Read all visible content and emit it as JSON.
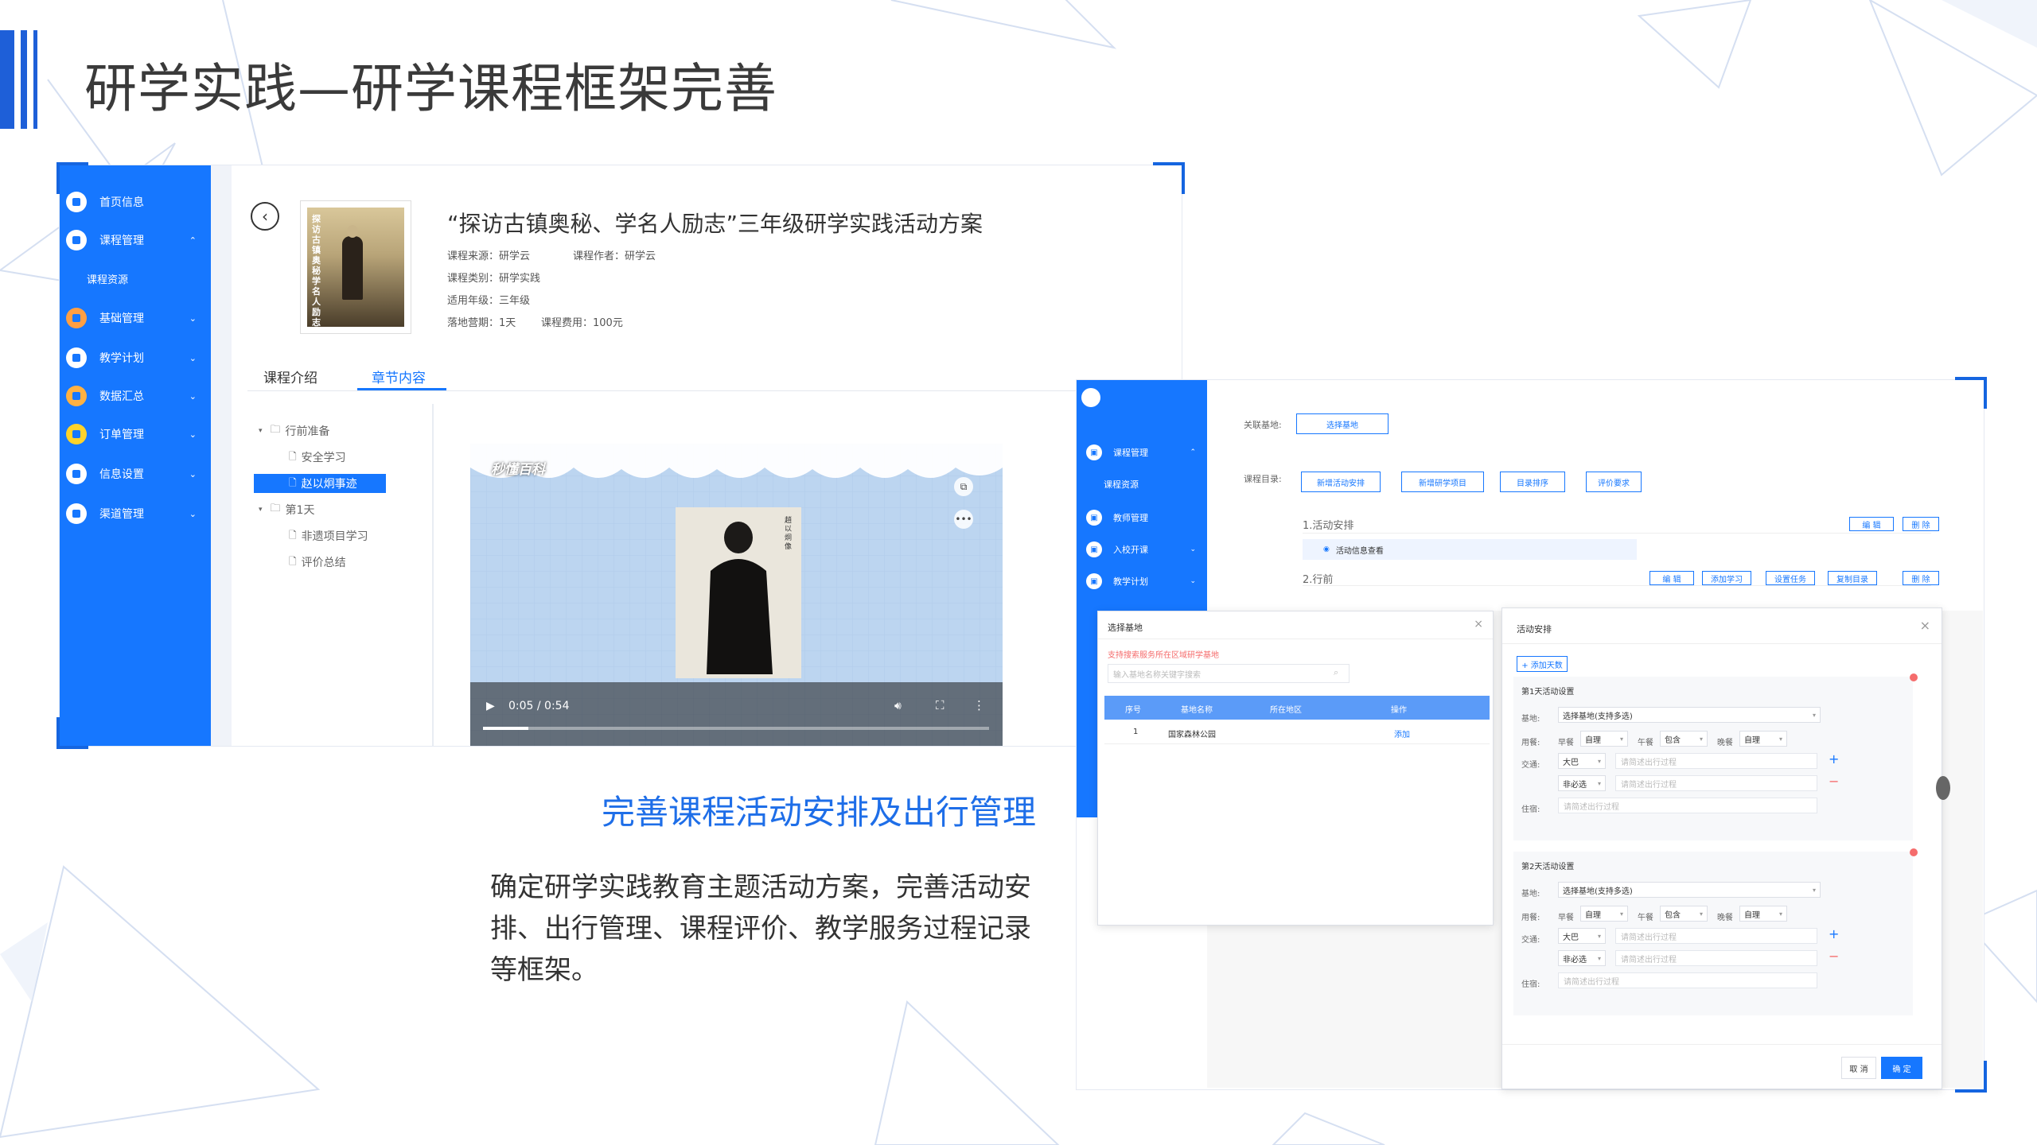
{
  "page": {
    "title": "研学实践—研学课程框架完善",
    "subhead": "完善课程活动安排及出行管理",
    "description": "确定研学实践教育主题活动方案，完善活动安排、出行管理、课程评价、教学服务过程记录等框架。"
  },
  "shot1": {
    "sidebar": [
      {
        "label": "首页信息",
        "icon": "home-icon",
        "expanded": false,
        "color": "#ffffff"
      },
      {
        "label": "课程管理",
        "icon": "course-icon",
        "expanded": true,
        "color": "#ffffff"
      },
      {
        "label": "课程资源",
        "icon": "",
        "sub": true
      },
      {
        "label": "基础管理",
        "icon": "basic-icon",
        "expanded": false,
        "color": "#ff9f43"
      },
      {
        "label": "教学计划",
        "icon": "monitor-icon",
        "expanded": false,
        "color": "#ffffff"
      },
      {
        "label": "数据汇总",
        "icon": "pie-icon",
        "expanded": false,
        "color": "#ffb142"
      },
      {
        "label": "订单管理",
        "icon": "clipboard-icon",
        "expanded": false,
        "color": "#ffd32a"
      },
      {
        "label": "信息设置",
        "icon": "gear-icon",
        "expanded": false,
        "color": "#ffffff"
      },
      {
        "label": "渠道管理",
        "icon": "channel-icon",
        "expanded": false,
        "color": "#ffffff"
      }
    ],
    "course": {
      "title": "“探访古镇奥秘、学名人励志”三年级研学实践活动方案",
      "source": "课程来源：研学云",
      "author": "课程作者：研学云",
      "category": "课程类别：研学实践",
      "grade": "适用年级：三年级",
      "duration": "落地营期：1天",
      "fee": "课程费用：100元",
      "cover_text": "探访古镇奥秘学名人励志"
    },
    "tabs": [
      "课程介绍",
      "章节内容"
    ],
    "active_tab": 1,
    "tree": [
      {
        "label": "行前准备",
        "type": "folder",
        "level": 0
      },
      {
        "label": "安全学习",
        "type": "file",
        "level": 1
      },
      {
        "label": "赵以炯事迹",
        "type": "file",
        "level": 1,
        "selected": true
      },
      {
        "label": "第1天",
        "type": "folder",
        "level": 0
      },
      {
        "label": "非遗项目学习",
        "type": "file",
        "level": 1
      },
      {
        "label": "评价总结",
        "type": "file",
        "level": 1
      }
    ],
    "video": {
      "watermark": "秒懂百科",
      "portrait_caption": "趙以炯像",
      "time": "0:05 / 0:54",
      "progress": 0.09
    }
  },
  "shot2": {
    "sidebar": [
      {
        "label": "课程管理",
        "icon": "course-icon",
        "chev": "⌃"
      },
      {
        "label": "课程资源",
        "icon": "",
        "sub": true
      },
      {
        "label": "教师管理",
        "icon": "teacher-icon",
        "chev": ""
      },
      {
        "label": "入校开课",
        "icon": "school-icon",
        "chev": "⌄"
      },
      {
        "label": "教学计划",
        "icon": "monitor-icon",
        "chev": "⌄"
      }
    ],
    "related_base_label": "关联基地:",
    "select_base_btn": "选择基地",
    "catalog_label": "课程目录:",
    "catalog_buttons": [
      "新增活动安排",
      "新增研学项目",
      "目录排序",
      "评价要求"
    ],
    "sections": [
      {
        "label": "1.活动安排",
        "buttons": [
          "编 辑",
          "删 除"
        ]
      },
      {
        "label": "2.行前",
        "buttons": [
          "编 辑",
          "添加学习",
          "设置任务",
          "复制目录",
          "删 除"
        ]
      }
    ],
    "sub_item": "活动信息查看",
    "base_modal": {
      "title": "选择基地",
      "hint": "支持搜索服务所在区域研学基地",
      "search_placeholder": "输入基地名称关键字搜索",
      "columns": [
        "序号",
        "基地名称",
        "所在地区",
        "操作"
      ],
      "rows": [
        {
          "no": "1",
          "name": "国家森林公园",
          "region": "",
          "action": "添加"
        }
      ]
    },
    "activity_modal": {
      "title": "活动安排",
      "add_days": "+ 添加天数",
      "days": [
        {
          "title": "第1天活动设置",
          "base_label": "基地:",
          "base_value": "选择基地(支持多选)",
          "meal_label": "用餐:",
          "breakfast_label": "早餐",
          "breakfast": "自理",
          "lunch_label": "午餐",
          "lunch": "包含",
          "dinner_label": "晚餐",
          "dinner": "自理",
          "traffic_label": "交通:",
          "traffic1": "大巴",
          "traffic2": "非必选",
          "traffic_placeholder": "请简述出行过程",
          "stay_label": "住宿:",
          "stay_placeholder": "请简述出行过程"
        },
        {
          "title": "第2天活动设置",
          "base_label": "基地:",
          "base_value": "选择基地(支持多选)",
          "meal_label": "用餐:",
          "breakfast_label": "早餐",
          "breakfast": "自理",
          "lunch_label": "午餐",
          "lunch": "包含",
          "dinner_label": "晚餐",
          "dinner": "自理",
          "traffic_label": "交通:",
          "traffic1": "大巴",
          "traffic2": "非必选",
          "traffic_placeholder": "请简述出行过程",
          "stay_label": "住宿:",
          "stay_placeholder": "请简述出行过程"
        }
      ],
      "cancel": "取 消",
      "confirm": "确 定"
    }
  },
  "colors": {
    "brand_blue": "#1677ff",
    "title_blue": "#1e6ee8",
    "accent_red": "#f56c6c"
  }
}
